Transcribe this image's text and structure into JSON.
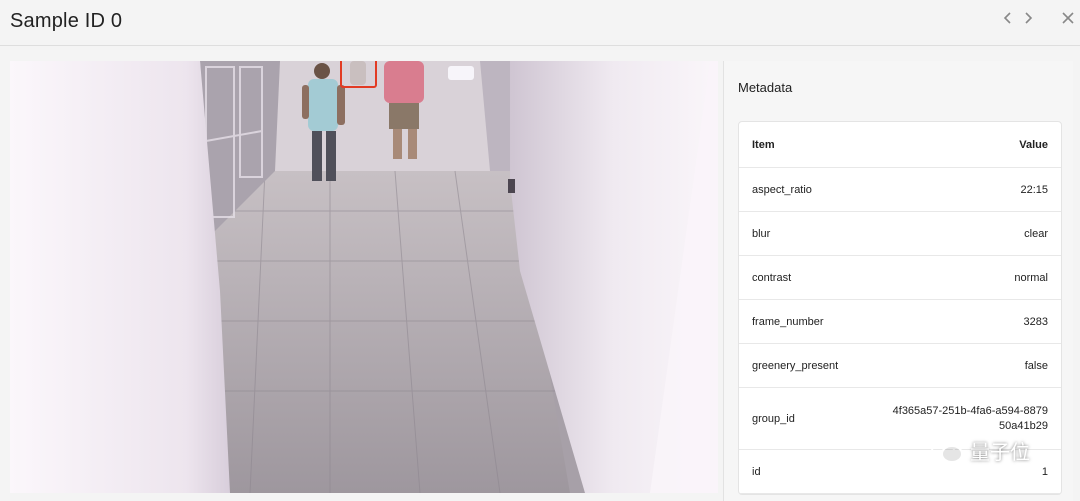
{
  "header": {
    "title": "Sample ID 0",
    "prev_icon": "chevron-left-icon",
    "next_icon": "chevron-right-icon",
    "close_icon": "close-icon"
  },
  "image": {
    "alt": "Surveillance camera frame of a corridor with pedestrians",
    "bbox_color": "#e23b24"
  },
  "metadata": {
    "title": "Metadata",
    "columns": [
      "Item",
      "Value"
    ],
    "rows": [
      {
        "item": "aspect_ratio",
        "value": "22:15"
      },
      {
        "item": "blur",
        "value": "clear"
      },
      {
        "item": "contrast",
        "value": "normal"
      },
      {
        "item": "frame_number",
        "value": "3283"
      },
      {
        "item": "greenery_present",
        "value": "false"
      },
      {
        "item": "group_id",
        "value": "4f365a57-251b-4fa6-a594-887950a41b29"
      },
      {
        "item": "id",
        "value": "1"
      }
    ]
  },
  "watermark": {
    "text": "量子位"
  }
}
